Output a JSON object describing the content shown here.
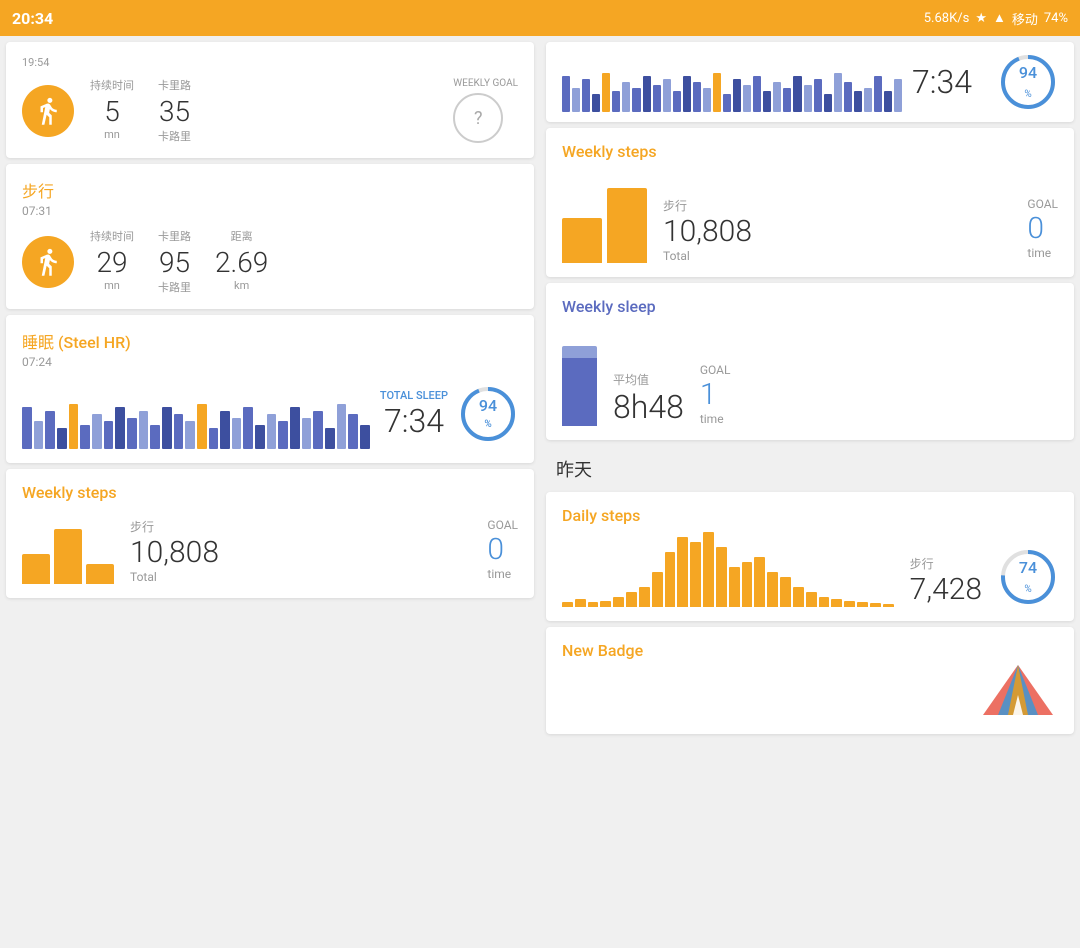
{
  "statusBar": {
    "time": "20:34",
    "network": "5.68K/s",
    "battery": "74%",
    "signal": "移动"
  },
  "leftCol": {
    "runCard": {
      "timeLabel": "持续时间",
      "calLabel": "卡里路",
      "weeklyGoalLabel": "WEEKLY GOAL",
      "duration": "5",
      "durationUnit": "mn",
      "calories": "35",
      "caloriesUnit": "卡路里",
      "goalSymbol": "?"
    },
    "walkCard": {
      "title": "步行",
      "time": "07:31",
      "timeLabel": "持续时间",
      "calLabel": "卡里路",
      "distLabel": "距离",
      "duration": "29",
      "durationUnit": "mn",
      "calories": "95",
      "caloriesUnit": "卡路里",
      "distance": "2.69",
      "distanceUnit": "km"
    },
    "sleepCard": {
      "title": "睡眠 (Steel HR)",
      "time": "07:24",
      "totalSleepLabel": "TOTAL SLEEP",
      "totalSleepValue": "7:34",
      "percent": "94",
      "percentSign": "%"
    },
    "weeklyStepsCard": {
      "title": "Weekly steps",
      "stepsLabel": "步行",
      "goalLabel": "GOAL",
      "totalLabel": "Total",
      "timeLabel": "time",
      "stepsValue": "10,808",
      "goalValue": "0",
      "bars": [
        30,
        55,
        20,
        0,
        0,
        0,
        0
      ]
    }
  },
  "rightCol": {
    "topCard": {
      "sleepTime": "7:34",
      "percent": "94",
      "percentSign": "%"
    },
    "weeklySteps": {
      "title": "Weekly steps",
      "stepsLabel": "步行",
      "goalLabel": "GOAL",
      "totalLabel": "Total",
      "timeLabel": "time",
      "stepsValue": "10,808",
      "goalValue": "0",
      "bars": [
        45,
        75,
        0,
        0,
        0,
        0,
        0
      ]
    },
    "weeklySleep": {
      "title": "Weekly sleep",
      "avgLabel": "平均值",
      "goalLabel": "GOAL",
      "timeLabel": "time",
      "avgValue": "8h48",
      "goalValue": "1"
    },
    "sectionYesterday": "昨天",
    "dailySteps": {
      "title": "Daily steps",
      "stepsLabel": "步行",
      "stepsValue": "7,428",
      "percent": "74",
      "percentSign": "%"
    },
    "newBadge": {
      "title": "New Badge"
    }
  }
}
